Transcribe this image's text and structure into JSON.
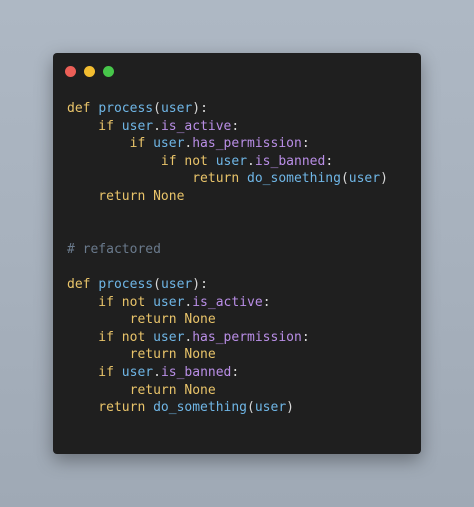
{
  "colors": {
    "dot_close": "#ec5f57",
    "dot_minimize": "#f3bd30",
    "dot_maximize": "#47c64a",
    "keyword": "#e9c46a",
    "identifier": "#6fb6e6",
    "attribute": "#b98ee6",
    "punctuation": "#d8d8d8",
    "comment": "#6a7a8c"
  },
  "code_lines": [
    [
      {
        "t": "def ",
        "c": "keyword"
      },
      {
        "t": "process",
        "c": "identifier"
      },
      {
        "t": "(",
        "c": "punctuation"
      },
      {
        "t": "user",
        "c": "identifier"
      },
      {
        "t": "):",
        "c": "punctuation"
      }
    ],
    [
      {
        "t": "    if ",
        "c": "keyword"
      },
      {
        "t": "user",
        "c": "identifier"
      },
      {
        "t": ".",
        "c": "punctuation"
      },
      {
        "t": "is_active",
        "c": "attribute"
      },
      {
        "t": ":",
        "c": "punctuation"
      }
    ],
    [
      {
        "t": "        if ",
        "c": "keyword"
      },
      {
        "t": "user",
        "c": "identifier"
      },
      {
        "t": ".",
        "c": "punctuation"
      },
      {
        "t": "has_permission",
        "c": "attribute"
      },
      {
        "t": ":",
        "c": "punctuation"
      }
    ],
    [
      {
        "t": "            if not ",
        "c": "keyword"
      },
      {
        "t": "user",
        "c": "identifier"
      },
      {
        "t": ".",
        "c": "punctuation"
      },
      {
        "t": "is_banned",
        "c": "attribute"
      },
      {
        "t": ":",
        "c": "punctuation"
      }
    ],
    [
      {
        "t": "                return ",
        "c": "keyword"
      },
      {
        "t": "do_something",
        "c": "identifier"
      },
      {
        "t": "(",
        "c": "punctuation"
      },
      {
        "t": "user",
        "c": "identifier"
      },
      {
        "t": ")",
        "c": "punctuation"
      }
    ],
    [
      {
        "t": "    return None",
        "c": "keyword"
      }
    ],
    [],
    [],
    [
      {
        "t": "# refactored",
        "c": "comment"
      }
    ],
    [],
    [
      {
        "t": "def ",
        "c": "keyword"
      },
      {
        "t": "process",
        "c": "identifier"
      },
      {
        "t": "(",
        "c": "punctuation"
      },
      {
        "t": "user",
        "c": "identifier"
      },
      {
        "t": "):",
        "c": "punctuation"
      }
    ],
    [
      {
        "t": "    if not ",
        "c": "keyword"
      },
      {
        "t": "user",
        "c": "identifier"
      },
      {
        "t": ".",
        "c": "punctuation"
      },
      {
        "t": "is_active",
        "c": "attribute"
      },
      {
        "t": ":",
        "c": "punctuation"
      }
    ],
    [
      {
        "t": "        return None",
        "c": "keyword"
      }
    ],
    [
      {
        "t": "    if not ",
        "c": "keyword"
      },
      {
        "t": "user",
        "c": "identifier"
      },
      {
        "t": ".",
        "c": "punctuation"
      },
      {
        "t": "has_permission",
        "c": "attribute"
      },
      {
        "t": ":",
        "c": "punctuation"
      }
    ],
    [
      {
        "t": "        return None",
        "c": "keyword"
      }
    ],
    [
      {
        "t": "    if ",
        "c": "keyword"
      },
      {
        "t": "user",
        "c": "identifier"
      },
      {
        "t": ".",
        "c": "punctuation"
      },
      {
        "t": "is_banned",
        "c": "attribute"
      },
      {
        "t": ":",
        "c": "punctuation"
      }
    ],
    [
      {
        "t": "        return None",
        "c": "keyword"
      }
    ],
    [
      {
        "t": "    return ",
        "c": "keyword"
      },
      {
        "t": "do_something",
        "c": "identifier"
      },
      {
        "t": "(",
        "c": "punctuation"
      },
      {
        "t": "user",
        "c": "identifier"
      },
      {
        "t": ")",
        "c": "punctuation"
      }
    ]
  ]
}
